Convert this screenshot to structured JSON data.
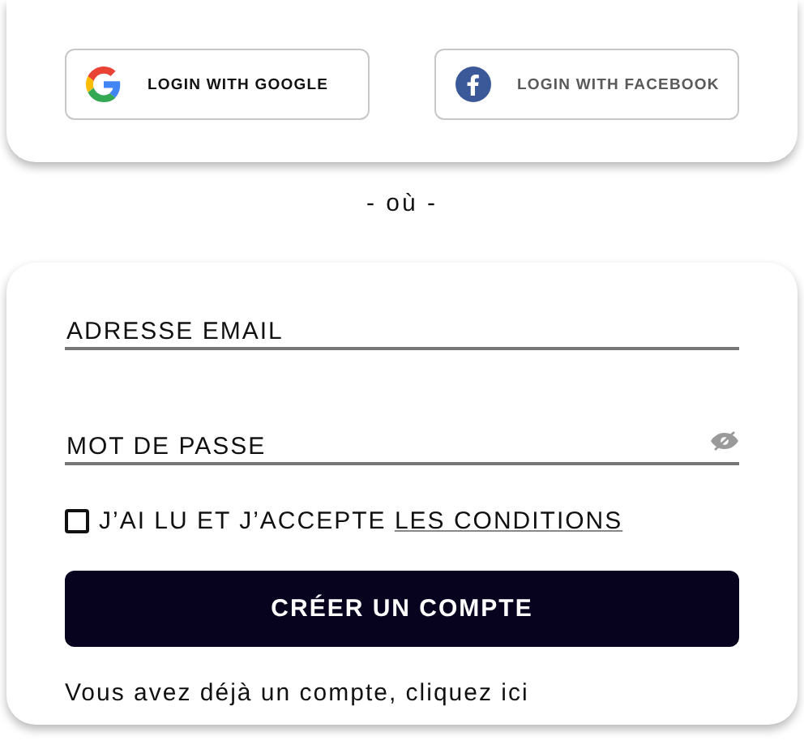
{
  "social_buttons": [
    {
      "kind": "google",
      "label": "LOGIN WITH GOOGLE"
    },
    {
      "kind": "facebook",
      "label": "LOGIN WITH FACEBOOK"
    }
  ],
  "separator": "- où -",
  "fields": [
    {
      "kind": "email",
      "placeholder": "ADRESSE EMAIL"
    },
    {
      "kind": "password",
      "placeholder": "MOT DE PASSE"
    }
  ],
  "terms": {
    "checked": false,
    "text": "J’AI LU ET J’ACCEPTE ",
    "link": "LES CONDITIONS"
  },
  "submit": "CRÉER UN COMPTE",
  "footer": "Vous avez déjà un compte, cliquez ici"
}
